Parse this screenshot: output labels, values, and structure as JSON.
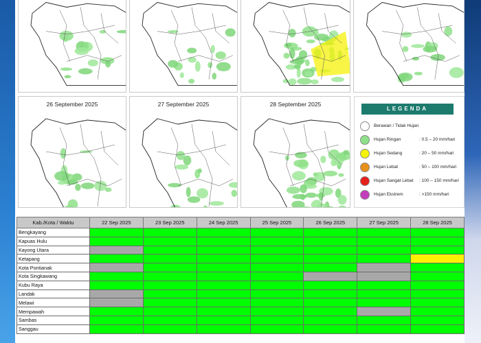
{
  "maps": {
    "top_row": [
      {
        "date": ""
      },
      {
        "date": ""
      },
      {
        "date": ""
      },
      {
        "date": ""
      }
    ],
    "bottom_row": [
      {
        "date": "26 September 2025"
      },
      {
        "date": "27 September 2025"
      },
      {
        "date": "28 September 2025"
      }
    ]
  },
  "legend": {
    "title": "LEGENDA",
    "items": [
      {
        "label": "Berawan / Tidak Hujan",
        "range": "",
        "color": "#ffffff"
      },
      {
        "label": "Hujan Ringan",
        "range": ": 0.5 – 20 mm/hari",
        "color": "#8fe08a"
      },
      {
        "label": "Hujan Sedang",
        "range": ": 20 – 50 mm/hari",
        "color": "#f5f20a"
      },
      {
        "label": "Hujan Lebat",
        "range": ": 50 – 100 mm/hari",
        "color": "#e8901c"
      },
      {
        "label": "Hujan Sangat Lebat",
        "range": ": 100 – 150 mm/hari",
        "color": "#e4201a"
      },
      {
        "label": "Hujan Ekstrem",
        "range": ": >150 mm/hari",
        "color": "#c23dbc"
      }
    ]
  },
  "table": {
    "header_first": "Kab./Kota / Waktu",
    "dates": [
      "22 Sep 2025",
      "23 Sep 2025",
      "24 Sep 2025",
      "25 Sep 2025",
      "26 Sep 2025",
      "27 Sep 2025",
      "28 Sep 2025"
    ],
    "colors": {
      "G": "#00ff00",
      "X": "#a8a8a8",
      "Y": "#ffef00"
    },
    "rows": [
      {
        "name": "Bengkayang",
        "status": [
          "G",
          "G",
          "G",
          "G",
          "G",
          "G",
          "G"
        ]
      },
      {
        "name": "Kapuas Hulu",
        "status": [
          "G",
          "G",
          "G",
          "G",
          "G",
          "G",
          "G"
        ]
      },
      {
        "name": "Kayong Utara",
        "status": [
          "X",
          "G",
          "G",
          "G",
          "G",
          "G",
          "G"
        ]
      },
      {
        "name": "Ketapang",
        "status": [
          "G",
          "G",
          "G",
          "G",
          "G",
          "G",
          "Y"
        ]
      },
      {
        "name": "Kota Pontianak",
        "status": [
          "X",
          "G",
          "G",
          "G",
          "G",
          "X",
          "G"
        ]
      },
      {
        "name": "Kota Singkawang",
        "status": [
          "G",
          "G",
          "G",
          "G",
          "X",
          "X",
          "G"
        ]
      },
      {
        "name": "Kubu Raya",
        "status": [
          "G",
          "G",
          "G",
          "G",
          "G",
          "G",
          "G"
        ]
      },
      {
        "name": "Landak",
        "status": [
          "X",
          "G",
          "G",
          "G",
          "G",
          "G",
          "G"
        ]
      },
      {
        "name": "Melawi",
        "status": [
          "X",
          "G",
          "G",
          "G",
          "G",
          "G",
          "G"
        ]
      },
      {
        "name": "Mempawah",
        "status": [
          "G",
          "G",
          "G",
          "G",
          "G",
          "X",
          "G"
        ]
      },
      {
        "name": "Sambas",
        "status": [
          "G",
          "G",
          "G",
          "G",
          "G",
          "G",
          "G"
        ]
      },
      {
        "name": "Sanggau",
        "status": [
          "G",
          "G",
          "G",
          "G",
          "G",
          "G",
          "G"
        ]
      }
    ]
  }
}
